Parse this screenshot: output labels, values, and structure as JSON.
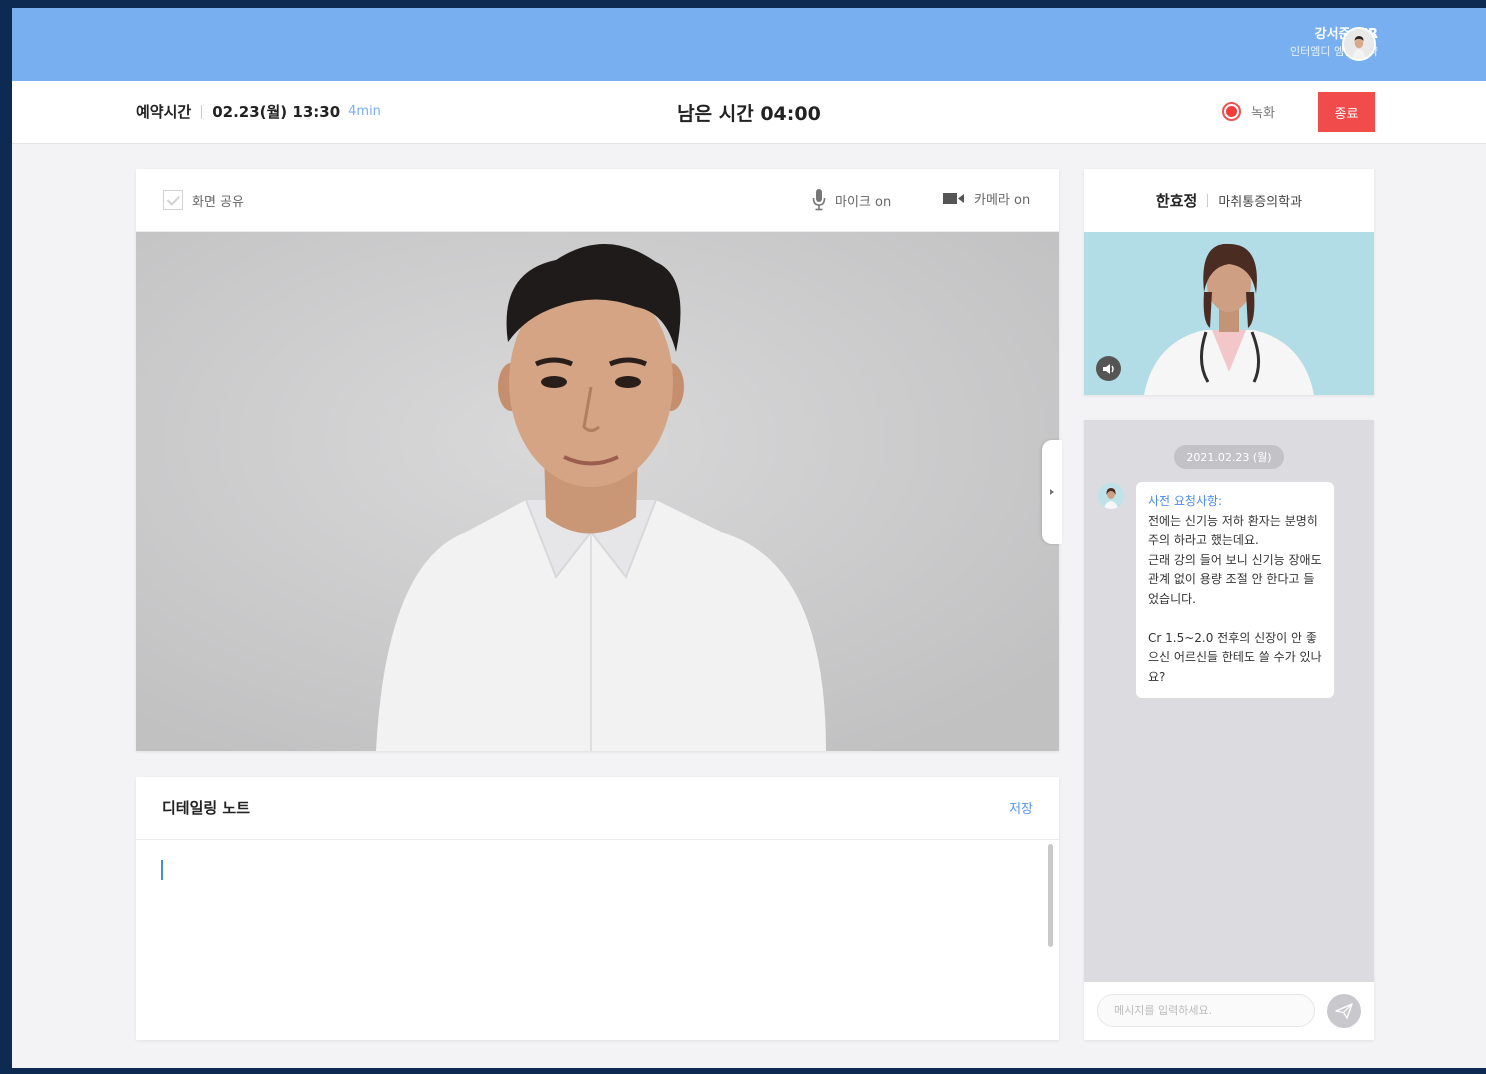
{
  "user": {
    "name": "강서준 MR",
    "company": "인터엠디 엠알 제약"
  },
  "header": {
    "reservation_label": "예약시간",
    "reservation_time": "02.23(월) 13:30",
    "duration": "4min",
    "remaining": "남은 시간  04:00",
    "record_label": "녹화",
    "end_label": "종료"
  },
  "video_toolbar": {
    "screen_share_label": "화면 공유",
    "mic_label": "마이크 on",
    "camera_label": "카메라 on"
  },
  "note": {
    "title": "디테일링 노트",
    "save_label": "저장",
    "value": ""
  },
  "doctor": {
    "name": "한효정",
    "department": "마취통증의학과"
  },
  "chat": {
    "date": "2021.02.23 (월)",
    "message_title": "사전 요청사항:",
    "message_body": "전에는 신기능 저하 환자는 분명히 주의 하라고 했는데요.\n근래 강의 들어 보니 신기능 장애도 관계 없이 용량 조절 안 한다고 들었습니다.\n\nCr 1.5~2.0 전후의 신장이 안 좋으신 어르신들 한테도 쓸 수가 있나요?",
    "input_placeholder": "메시지를 입력하세요."
  },
  "colors": {
    "topbar": "#78aff0",
    "end_button": "#f24b4b",
    "accent_blue": "#4a8be0",
    "record_red": "#f03c3c"
  },
  "icons": {
    "mic": "microphone-icon",
    "camera": "video-camera-icon",
    "speaker": "speaker-icon",
    "send": "paper-plane-icon",
    "record": "record-dot-icon",
    "checkbox": "checkbox-icon"
  }
}
